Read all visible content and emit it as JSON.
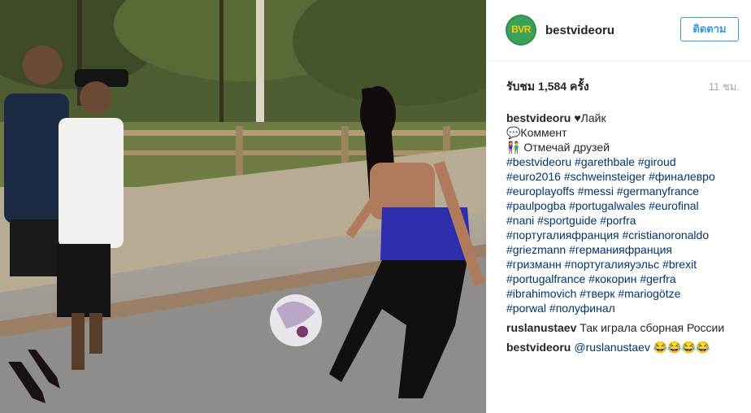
{
  "post": {
    "username": "bestvideoru",
    "avatar_text": "BVR",
    "follow_label": "ติดตาม",
    "views": "รับชม 1,584 ครั้ง",
    "time_ago": "11 ชม."
  },
  "caption": {
    "username": "bestvideoru",
    "lines": [
      "♥Лайк",
      "💬Коммент",
      "👫 Отмечай друзей"
    ],
    "hashtag_lines": [
      "#bestvideoru #garethbale #giroud",
      "#euro2016 #schweinsteiger #финалевро",
      "#europlayoffs #messi #germanyfrance",
      "#paulpogba #portugalwales #eurofinal",
      "#nani #sportguide #porfra",
      "#португалияфранция #cristianoronaldo",
      "#griezmann #германияфранция",
      "#гризманн #португалияуэльс #brexit",
      "#portugalfrance #кокорин #gerfra",
      "#ibrahimovich #тверк #mariogötze",
      "#porwal #полуфинал"
    ]
  },
  "comments": [
    {
      "username": "ruslanustaev",
      "text": "Так играла сборная России"
    },
    {
      "username": "bestvideoru",
      "mention": "@ruslanustaev",
      "text": "😂😂😂😂"
    }
  ],
  "colors": {
    "follow_blue": "#3897f0",
    "hashtag": "#003569",
    "avatar_green": "#2d8f4a"
  }
}
